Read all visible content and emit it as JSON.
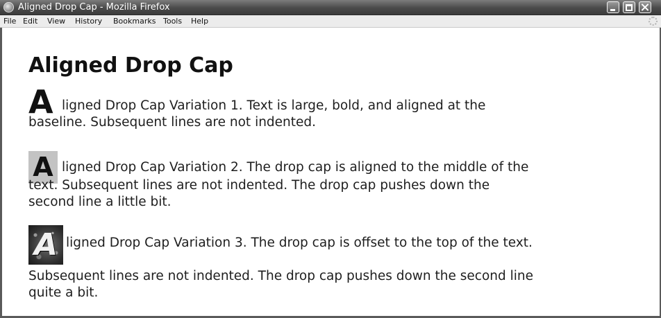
{
  "window": {
    "title": "Aligned Drop Cap - Mozilla Firefox",
    "icon": "firefox-icon",
    "controls": [
      "minimize-icon",
      "maximize-icon",
      "close-icon"
    ]
  },
  "menubar": {
    "items": [
      "File",
      "Edit",
      "View",
      "History",
      "Bookmarks",
      "Tools",
      "Help"
    ],
    "activity_icon": "throbber-icon"
  },
  "page": {
    "heading": "Aligned Drop Cap",
    "paragraphs": [
      {
        "drop_cap": "A",
        "lines": [
          "ligned Drop Cap Variation 1. Text is large, bold, and aligned at the",
          "baseline. Subsequent lines are not indented."
        ]
      },
      {
        "drop_cap": "A",
        "lines": [
          "ligned Drop Cap Variation 2. The drop cap is aligned to the middle of the",
          "text. Subsequent lines are not indented. The drop cap pushes down the",
          "second line a little bit."
        ]
      },
      {
        "drop_cap": "A",
        "lines": [
          "ligned Drop Cap Variation 3. The drop cap is offset to the top of the text.",
          "Subsequent lines are not indented. The drop cap pushes down the second line",
          "quite a bit."
        ]
      }
    ]
  },
  "colors": {
    "titlebar": "#4a4a4a",
    "menubar": "#ececec",
    "drop_cap_2_background": "#c3c3c3",
    "drop_cap_3_background": "#2d2d2d"
  }
}
